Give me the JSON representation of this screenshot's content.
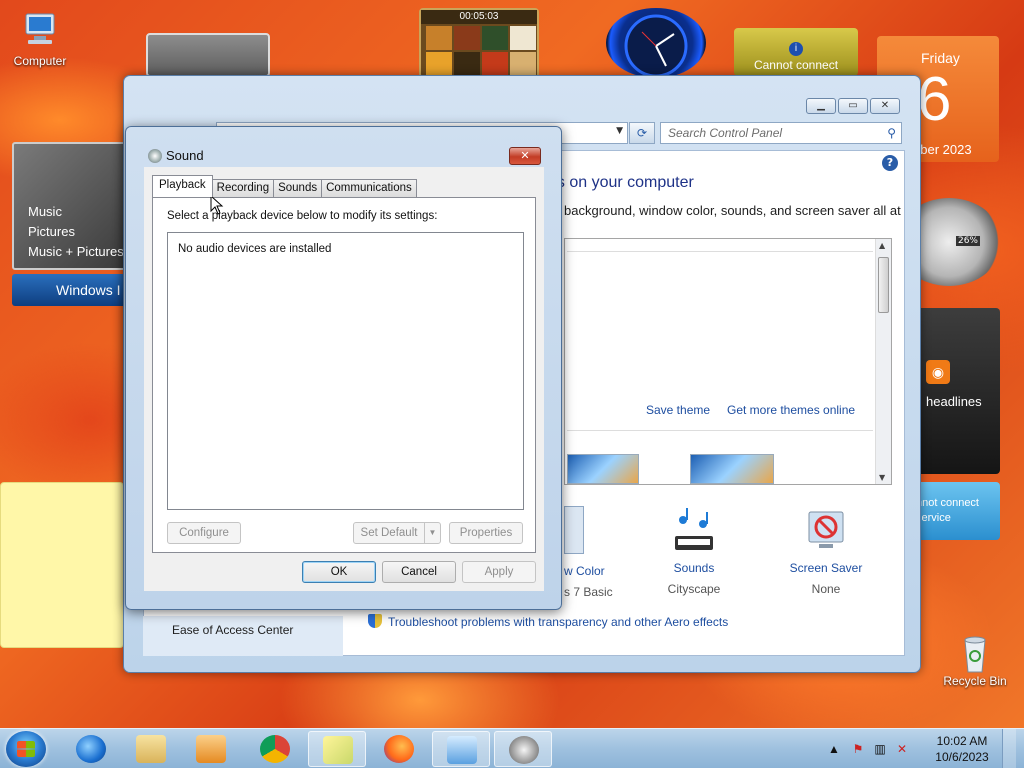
{
  "desktop": {
    "computer_label": "Computer",
    "recycle_label": "Recycle Bin"
  },
  "gadgets": {
    "puzzle_timer": "00:05:03",
    "weather_status": "Cannot connect",
    "calendar_day": "Friday",
    "calendar_date": "6",
    "calendar_month": "ober 2023",
    "meter_percent": "26%",
    "feeds_label": "headlines",
    "service_line1": "nnot connect",
    "service_line2": "service",
    "media_items": [
      "Music",
      "Pictures",
      "Music + Pictures"
    ],
    "media_bar_label": "Windows I"
  },
  "control_panel": {
    "search_placeholder": "Search Control Panel",
    "heading": "ds on your computer",
    "subheading": "background, window color, sounds, and screen saver all at",
    "save_theme": "Save theme",
    "get_more_themes": "Get more themes online",
    "items": [
      {
        "label": "w Color",
        "sub": "s 7 Basic"
      },
      {
        "label": "Sounds",
        "sub": "Cityscape"
      },
      {
        "label": "Screen Saver",
        "sub": "None"
      }
    ],
    "ease_of_access": "Ease of Access Center",
    "troubleshoot": "Troubleshoot problems with transparency and other Aero effects"
  },
  "sound_dialog": {
    "title": "Sound",
    "tabs": [
      "Playback",
      "Recording",
      "Sounds",
      "Communications"
    ],
    "active_tab": "Playback",
    "instruction": "Select a playback device below to modify its settings:",
    "empty_message": "No audio devices are installed",
    "configure": "Configure",
    "set_default": "Set Default",
    "properties": "Properties",
    "ok": "OK",
    "cancel": "Cancel",
    "apply": "Apply"
  },
  "taskbar": {
    "time": "10:02 AM",
    "date": "10/6/2023"
  }
}
